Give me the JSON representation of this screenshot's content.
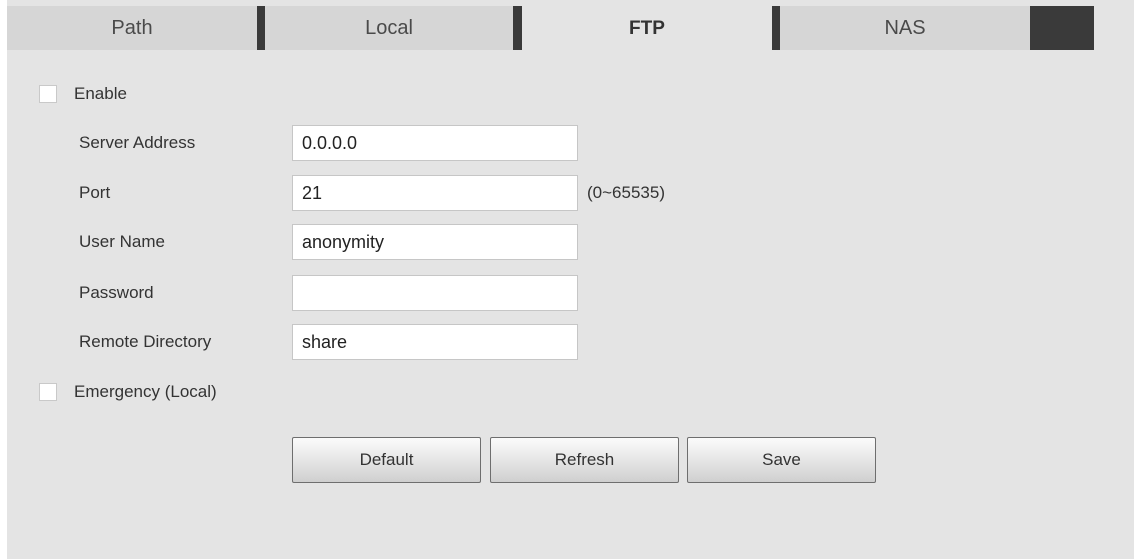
{
  "tabs": [
    {
      "label": "Path",
      "active": false
    },
    {
      "label": "Local",
      "active": false
    },
    {
      "label": "FTP",
      "active": true
    },
    {
      "label": "NAS",
      "active": false
    }
  ],
  "enable": {
    "label": "Enable",
    "checked": false
  },
  "fields": {
    "server_address": {
      "label": "Server Address",
      "value": "0.0.0.0"
    },
    "port": {
      "label": "Port",
      "value": "21",
      "hint": "(0~65535)"
    },
    "user_name": {
      "label": "User Name",
      "value": "anonymity"
    },
    "password": {
      "label": "Password",
      "value": ""
    },
    "remote_directory": {
      "label": "Remote Directory",
      "value": "share"
    }
  },
  "emergency": {
    "label": "Emergency (Local)",
    "checked": false
  },
  "buttons": {
    "default": "Default",
    "refresh": "Refresh",
    "save": "Save"
  }
}
